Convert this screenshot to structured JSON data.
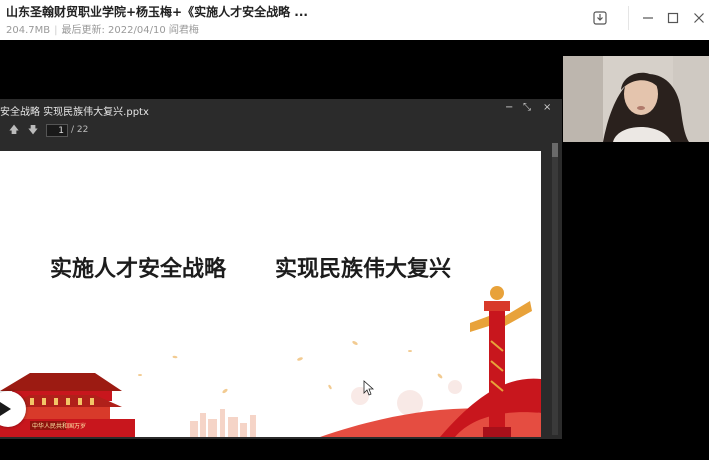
{
  "header": {
    "title": "山东圣翰财贸职业学院+杨玉梅+《实施人才安全战略 ...",
    "size": "204.7MB",
    "updated": "最后更新: 2022/04/10 阎君梅"
  },
  "icons": {
    "download": "download-icon",
    "minimize": "minimize-icon",
    "maximize": "maximize-icon",
    "close": "close-icon",
    "play": "play-icon",
    "cursor": "cursor-icon"
  },
  "ppt": {
    "window_title": "安全战略 实现民族伟大复兴.pptx",
    "current_page": "1",
    "total_pages": "/ 22"
  },
  "slide": {
    "heading_left": "实施人才安全战略",
    "heading_right": "实现民族伟大复兴",
    "banner_text": "中华人民共和国万岁"
  },
  "colors": {
    "accent_red": "#c8161d",
    "gold": "#e8a23a",
    "stage": "#000000"
  }
}
